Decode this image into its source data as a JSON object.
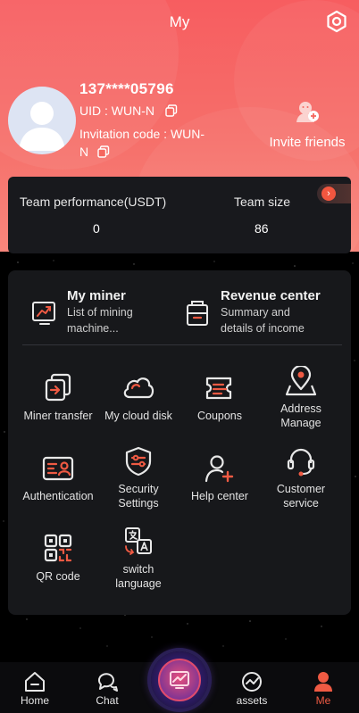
{
  "header": {
    "title": "My",
    "phone": "137****05796",
    "uid_label": "UID : WUN-N",
    "invitation_line1": "Invitation code : WUN-",
    "invitation_line2": "N",
    "invite_label": "Invite friends"
  },
  "team": {
    "performance_label": "Team performance(USDT)",
    "performance_value": "0",
    "size_label": "Team size",
    "size_value": "86"
  },
  "features": [
    {
      "title": "My miner",
      "subtitle_line1": "List of mining",
      "subtitle_line2": "machine..."
    },
    {
      "title": "Revenue center",
      "subtitle_line1": "Summary and",
      "subtitle_line2": "details of income"
    }
  ],
  "menu": {
    "miner_transfer": "Miner transfer",
    "cloud_disk": "My cloud disk",
    "coupons": "Coupons",
    "address_line1": "Address",
    "address_line2": "Manage",
    "authentication": "Authentication",
    "security_line1": "Security",
    "security_line2": "Settings",
    "help_center": "Help center",
    "customer_line1": "Customer",
    "customer_line2": "service",
    "qr_code": "QR code",
    "switch_line1": "switch",
    "switch_line2": "language"
  },
  "nav": {
    "home": "Home",
    "chat": "Chat",
    "assets": "assets",
    "me": "Me"
  },
  "colors": {
    "accent": "#ef5a43",
    "header_top": "#f75d60",
    "card_bg": "#17181b"
  }
}
